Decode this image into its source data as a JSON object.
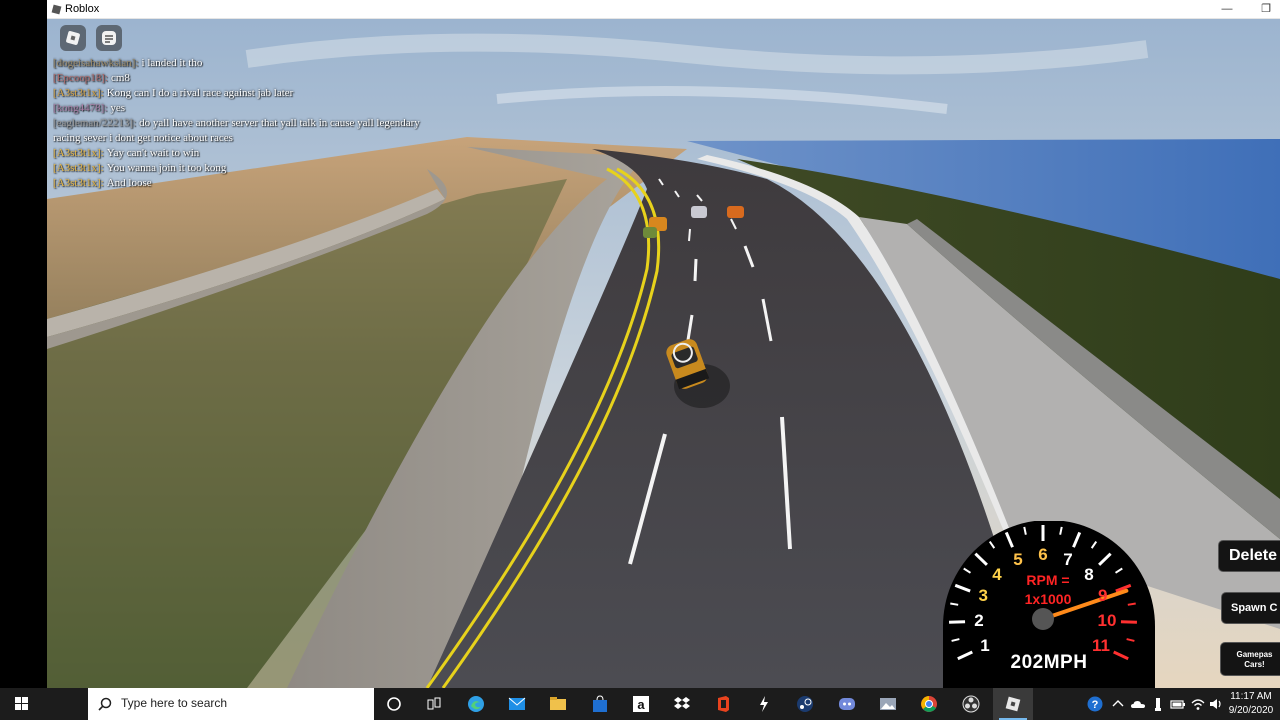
{
  "window": {
    "title": "Roblox",
    "minimize_glyph": "—",
    "restore_glyph": "❐"
  },
  "chat": {
    "messages": [
      {
        "name": "[dogeisahawkslan]:",
        "text": "i landed it tho",
        "name_color": "#9a8a6a",
        "wrap": false
      },
      {
        "name": "[Epcoop18]:",
        "text": "cm8",
        "name_color": "#b26a6a",
        "wrap": false
      },
      {
        "name": "[A3st3t1x]:",
        "text": "Kong can I do a rival race against jab later",
        "name_color": "#d6a64a",
        "wrap": false
      },
      {
        "name": "[kong4478]:",
        "text": "yes",
        "name_color": "#a87fa6",
        "wrap": false
      },
      {
        "name": "[eagleman/22213]:",
        "text": "do yall have another server that yall talk in cause yall legendary racing sever i dont get notice about races",
        "name_color": "#9a9a9a",
        "wrap": true
      },
      {
        "name": "[A3st3t1x]:",
        "text": "Yay can't wait to win",
        "name_color": "#e6b84a",
        "wrap": false
      },
      {
        "name": "[A3st3t1x]:",
        "text": "You wanna join it too kong",
        "name_color": "#e6b84a",
        "wrap": false
      },
      {
        "name": "[A3st3t1x]:",
        "text": "And loose",
        "name_color": "#e6b84a",
        "wrap": false
      }
    ]
  },
  "speedometer": {
    "numbers": [
      "1",
      "2",
      "3",
      "4",
      "5",
      "6",
      "7",
      "8",
      "9",
      "10",
      "11"
    ],
    "rpm_line1": "RPM =",
    "rpm_line2": "1x1000",
    "speed": "202MPH",
    "needle_value": 9.1
  },
  "side_buttons": {
    "delete": "Delete",
    "spawn": "Spawn C",
    "gamepass_line1": "Gamepas",
    "gamepass_line2": "Cars!"
  },
  "taskbar": {
    "search_placeholder": "Type here to search",
    "apps": [
      "cortana-icon",
      "task-view-icon",
      "edge-icon",
      "mail-icon",
      "file-explorer-icon",
      "store-icon",
      "amazon-icon",
      "dropbox-icon",
      "office-icon",
      "lightning-app-icon",
      "steam-icon",
      "discord-icon",
      "photos-icon",
      "chrome-icon",
      "obs-icon",
      "roblox-icon"
    ],
    "clock_time": "11:17 AM",
    "clock_date": "9/20/2020"
  },
  "colors": {
    "accent": "#0078d7",
    "taskbar": "#1c1c1c",
    "rpm_red": "#ff2424",
    "needle": "#ff8a1a"
  }
}
